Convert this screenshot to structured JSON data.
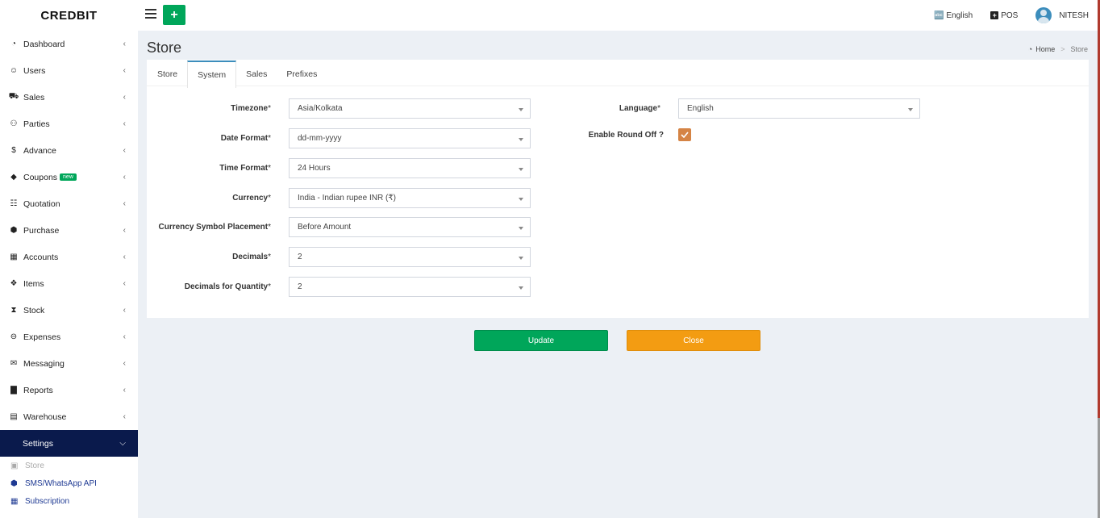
{
  "brand": "CREDBIT",
  "header": {
    "language": "English",
    "pos": "POS",
    "user": "NITESH"
  },
  "sidebar": {
    "items": [
      {
        "label": "Dashboard",
        "icon": "dashboard-icon",
        "glyph": "◔"
      },
      {
        "label": "Users",
        "icon": "user-plus-icon",
        "glyph": "☺"
      },
      {
        "label": "Sales",
        "icon": "cart-icon",
        "glyph": "⛟"
      },
      {
        "label": "Parties",
        "icon": "users-icon",
        "glyph": "⚇"
      },
      {
        "label": "Advance",
        "icon": "dollar-icon",
        "glyph": "$"
      },
      {
        "label": "Coupons",
        "icon": "tag-icon",
        "glyph": "◆",
        "badge": "new"
      },
      {
        "label": "Quotation",
        "icon": "calendar-plus-icon",
        "glyph": "☷"
      },
      {
        "label": "Purchase",
        "icon": "cube-icon",
        "glyph": "⬢"
      },
      {
        "label": "Accounts",
        "icon": "grid-icon",
        "glyph": "▦"
      },
      {
        "label": "Items",
        "icon": "cubes-icon",
        "glyph": "❖"
      },
      {
        "label": "Stock",
        "icon": "hourglass-icon",
        "glyph": "⧗"
      },
      {
        "label": "Expenses",
        "icon": "minus-circle-icon",
        "glyph": "⊖"
      },
      {
        "label": "Messaging",
        "icon": "envelope-icon",
        "glyph": "✉"
      },
      {
        "label": "Reports",
        "icon": "bar-chart-icon",
        "glyph": "▇"
      },
      {
        "label": "Warehouse",
        "icon": "building-icon",
        "glyph": "▤"
      }
    ],
    "settings": {
      "label": "Settings"
    },
    "sub_items": [
      {
        "label": "Store",
        "icon": "briefcase-icon",
        "glyph": "▣"
      },
      {
        "label": "SMS/WhatsApp API",
        "icon": "cube-icon",
        "glyph": "⬢"
      },
      {
        "label": "Subscription",
        "icon": "calendar-icon",
        "glyph": "▦"
      }
    ]
  },
  "page": {
    "title": "Store",
    "breadcrumb": {
      "home": "Home",
      "current": "Store"
    }
  },
  "tabs": [
    "Store",
    "System",
    "Sales",
    "Prefixes"
  ],
  "active_tab": "System",
  "form": {
    "timezone": {
      "label": "Timezone",
      "value": "Asia/Kolkata"
    },
    "date_format": {
      "label": "Date Format",
      "value": "dd-mm-yyyy"
    },
    "time_format": {
      "label": "Time Format",
      "value": "24 Hours"
    },
    "currency": {
      "label": "Currency",
      "value": "India - Indian rupee INR (₹)"
    },
    "currency_symbol_placement": {
      "label": "Currency Symbol Placement",
      "value": "Before Amount"
    },
    "decimals": {
      "label": "Decimals",
      "value": "2"
    },
    "decimals_quantity": {
      "label": "Decimals for Quantity",
      "value": "2"
    },
    "language": {
      "label": "Language",
      "value": "English"
    },
    "round_off": {
      "label": "Enable Round Off ?",
      "checked": true
    },
    "required_mark": "*"
  },
  "buttons": {
    "update": "Update",
    "close": "Close"
  },
  "colors": {
    "accent_green": "#00a65a",
    "accent_orange": "#f39c12",
    "sidebar_active": "#0a1a4c",
    "checkbox": "#d58445",
    "tab_active": "#3c8dbc"
  }
}
